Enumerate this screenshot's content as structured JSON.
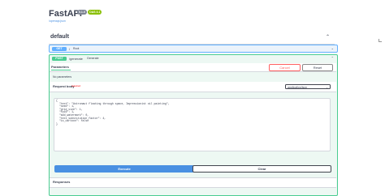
{
  "app": {
    "title": "FastAPI",
    "version_badge": "0.1.0",
    "oas_badge": "OAS 3.1",
    "openapi_link": "/openapi.json"
  },
  "tag": {
    "name": "default"
  },
  "ops": [
    {
      "method": "GET",
      "path": "/",
      "summary": "Root"
    },
    {
      "method": "POST",
      "path": "/generate",
      "summary": "Generate"
    }
  ],
  "post_panel": {
    "parameters_title": "Parameters",
    "cancel_label": "Cancel",
    "reset_label": "Reset",
    "no_params_text": "No parameters",
    "request_body_title": "Request body",
    "required_label": "required",
    "content_type": "application/json",
    "body_lines": [
      "{",
      "  \"text\": \"Astronaut floating through space, Impressionist oil painting\",",
      "  \"seed\": 1,",
      "  \"grid_size\": 1,",
      "  \"fp16\": 1,",
      "  \"add_watermark\": 0,",
      "  \"text_substitution_factor\": 4,",
      "  \"is_cartoon\": false",
      "}"
    ],
    "execute_label": "Execute",
    "clear_label": "Clear",
    "responses_title": "Responses"
  },
  "colors": {
    "get": "#61affe",
    "post": "#49cc90",
    "execute": "#4990e2",
    "cancel": "#ff6060"
  },
  "icons": {
    "tag_collapse": "chevron-up-icon",
    "op_toggle": "chevron-down-icon"
  }
}
